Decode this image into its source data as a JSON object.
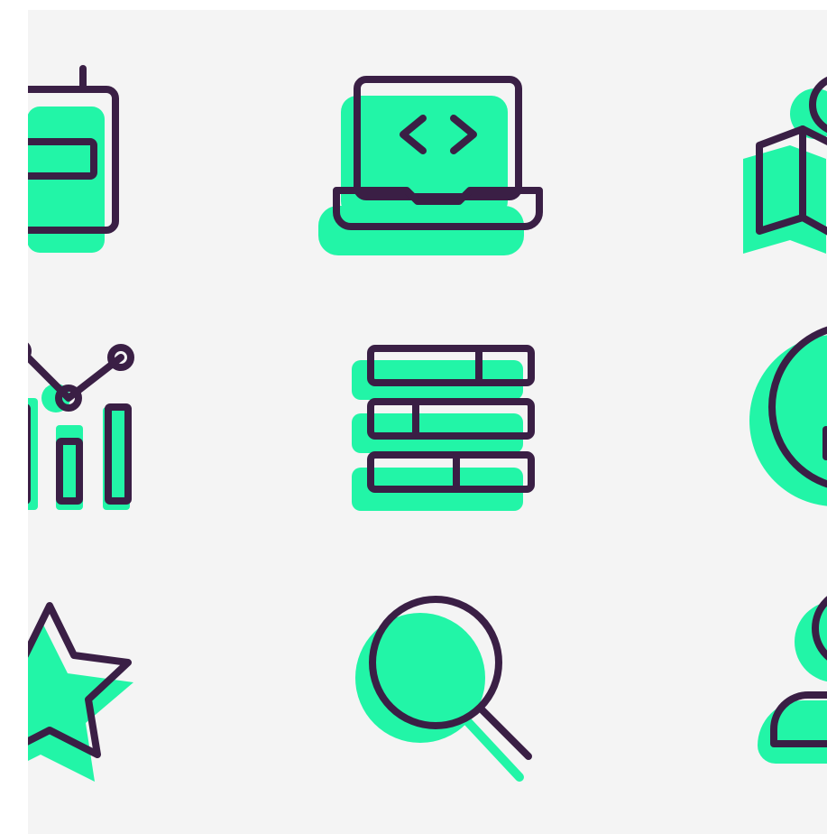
{
  "colors": {
    "background": "#f4f4f4",
    "accent": "#22f5a7",
    "stroke": "#3a1f45"
  },
  "icons": [
    {
      "name": "walkie-talkie-icon"
    },
    {
      "name": "laptop-code-icon"
    },
    {
      "name": "map-location-icon"
    },
    {
      "name": "analytics-chart-icon"
    },
    {
      "name": "table-rows-icon"
    },
    {
      "name": "info-circle-icon"
    },
    {
      "name": "star-icon"
    },
    {
      "name": "search-icon"
    },
    {
      "name": "user-icon"
    }
  ]
}
